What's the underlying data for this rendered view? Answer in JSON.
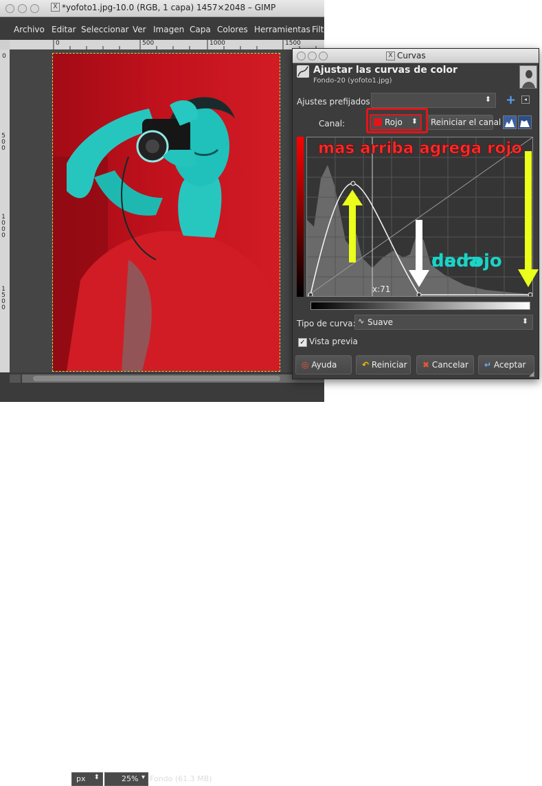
{
  "gimp": {
    "title": "*yofoto1.jpg-10.0 (RGB, 1 capa) 1457×2048 – GIMP",
    "menus": [
      "Archivo",
      "Editar",
      "Seleccionar",
      "Ver",
      "Imagen",
      "Capa",
      "Colores",
      "Herramientas",
      "Filt"
    ],
    "ruler_top": [
      "0",
      "500",
      "1000",
      "1500"
    ],
    "ruler_left": [
      "0",
      "500",
      "1000",
      "1500"
    ],
    "status": {
      "unit": "px",
      "zoom": "25%",
      "text": "Fondo (61.3 MB)"
    }
  },
  "curves": {
    "title": "Curvas",
    "heading": "Ajustar las curvas de color",
    "subheading": "Fondo-20 (yofoto1.jpg)",
    "presets_label": "Ajustes prefijados:",
    "channel_label": "Canal:",
    "channel_value": "Rojo",
    "reset_channel_label": "Reiniciar el canal",
    "x_readout": "x:71",
    "curve_type_label": "Tipo de curva:",
    "curve_type_value": "Suave",
    "preview_label": "Vista previa",
    "preview_checked": true,
    "buttons": {
      "help": "Ayuda",
      "reset": "Reiniciar",
      "cancel": "Cancelar",
      "ok": "Aceptar"
    }
  },
  "annotations": {
    "top": "mas arriba agrega rojo",
    "right_line1": "nada",
    "right_line2": "de rojo"
  },
  "colors": {
    "annotation_red": "#ff2a2a",
    "annotation_cyan": "#18d5c8",
    "arrow_yellow": "#eaff1a",
    "highlight_box": "#e0161b"
  }
}
